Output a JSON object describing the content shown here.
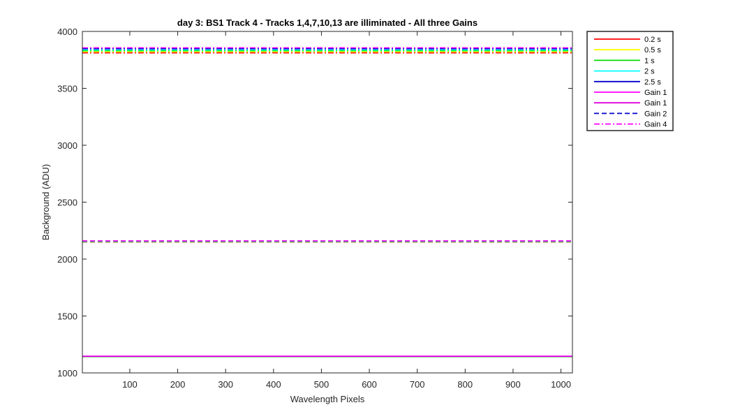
{
  "chart_data": {
    "type": "line",
    "title": "day 3: BS1  Track 4 - Tracks 1,4,7,10,13 are illiminated - All three Gains",
    "xlabel": "Wavelength Pixels",
    "ylabel": "Background (ADU)",
    "xlim": [
      1,
      1024
    ],
    "ylim": [
      1000,
      4000
    ],
    "xticks": [
      100,
      200,
      300,
      400,
      500,
      600,
      700,
      800,
      900,
      1000
    ],
    "yticks": [
      1000,
      1500,
      2000,
      2500,
      3000,
      3500,
      4000
    ],
    "grid": false,
    "legend_position": "outside-top-right",
    "series": [
      {
        "name": "0.2 s",
        "color": "#ff0000",
        "style": "solid"
      },
      {
        "name": "0.5 s",
        "color": "#ffff00",
        "style": "solid"
      },
      {
        "name": "1 s",
        "color": "#00dd00",
        "style": "solid"
      },
      {
        "name": "2 s",
        "color": "#00ffff",
        "style": "solid"
      },
      {
        "name": "2.5 s",
        "color": "#0000cc",
        "style": "solid"
      },
      {
        "name": "Gain 1",
        "color": "#ff00ff",
        "style": "solid"
      },
      {
        "name": "Gain 1",
        "color": "#dd00dd",
        "style": "solid"
      },
      {
        "name": "Gain 2",
        "color": "#0000cc",
        "style": "dashed"
      },
      {
        "name": "Gain 4",
        "color": "#ff00ff",
        "style": "dashdot"
      }
    ],
    "bands": [
      {
        "label": "Gain 4",
        "style": "dashdot",
        "values": [
          3812,
          3822,
          3830,
          3838,
          3848,
          3856
        ]
      },
      {
        "label": "Gain 2",
        "style": "dashed",
        "values": [
          2150,
          2152,
          2154,
          2156,
          2158,
          2160
        ]
      },
      {
        "label": "Gain 1",
        "style": "solid",
        "values": [
          1142,
          1143,
          1144,
          1145,
          1146,
          1147
        ]
      }
    ],
    "band_colors": [
      "#ff0000",
      "#ffff00",
      "#00dd00",
      "#00ffff",
      "#0000cc",
      "#ff00ff"
    ]
  }
}
